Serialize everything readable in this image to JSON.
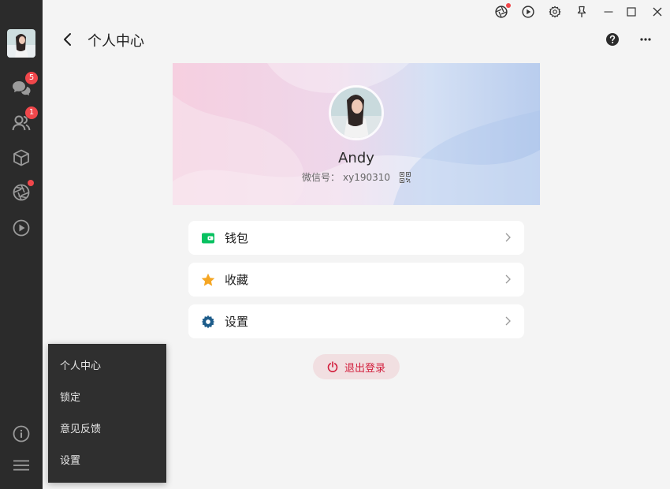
{
  "sidebar": {
    "chat_badge": "5",
    "contacts_badge": "1"
  },
  "header": {
    "title": "个人中心"
  },
  "profile": {
    "name": "Andy",
    "wechat_id_label": "微信号：",
    "wechat_id": "xy190310"
  },
  "menu": [
    {
      "label": "钱包",
      "icon": "wallet-icon",
      "color": "#07c160"
    },
    {
      "label": "收藏",
      "icon": "star-icon",
      "color": "#f5a623"
    },
    {
      "label": "设置",
      "icon": "gear-icon",
      "color": "#1d5c8a"
    }
  ],
  "logout": {
    "label": "退出登录",
    "color": "#d21e3c"
  },
  "popup_menu": [
    "个人中心",
    "锁定",
    "意见反馈",
    "设置"
  ]
}
